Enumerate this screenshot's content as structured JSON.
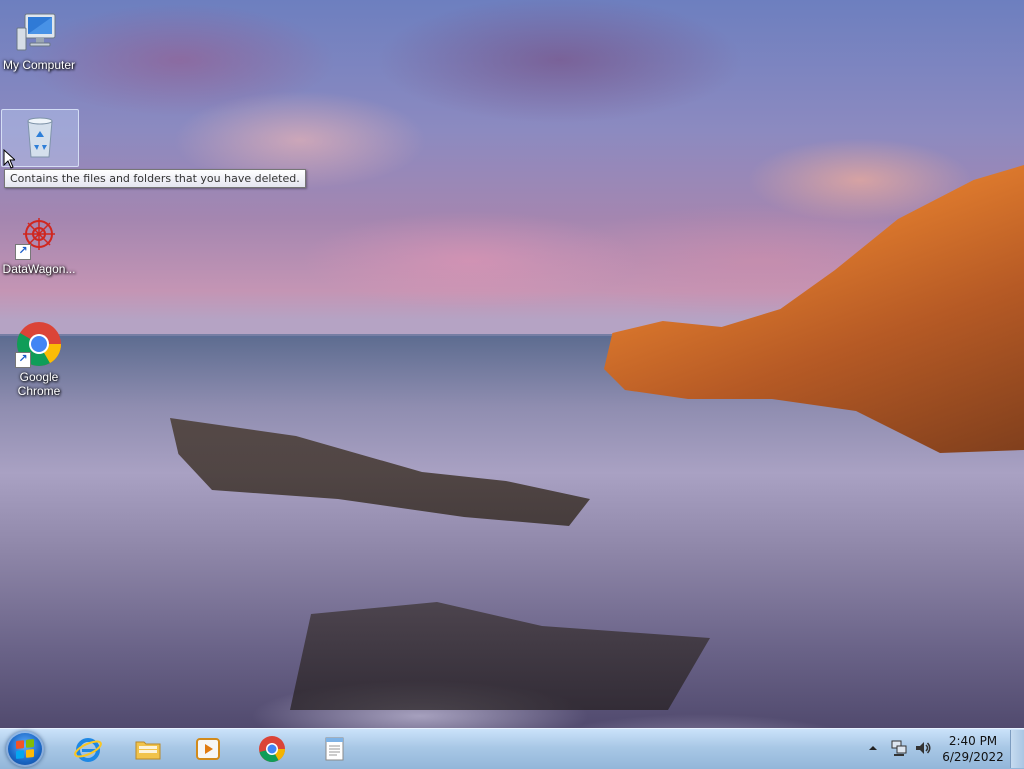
{
  "desktop": {
    "icons": [
      {
        "label": "My Computer",
        "icon": "computer-icon"
      },
      {
        "label": "Recycle Bin",
        "icon": "recycle-bin-icon",
        "selected": true
      },
      {
        "label": "DataWagon...",
        "icon": "datawagon-icon",
        "shortcut": true
      },
      {
        "label": "Google Chrome",
        "icon": "chrome-icon",
        "shortcut": true
      }
    ],
    "tooltip": "Contains the files and folders that you have deleted."
  },
  "taskbar": {
    "start": {
      "icon": "windows-start-icon"
    },
    "pinned": [
      {
        "name": "Internet Explorer",
        "icon": "internet-explorer-icon"
      },
      {
        "name": "Windows Explorer",
        "icon": "folder-icon"
      },
      {
        "name": "Windows Media Player",
        "icon": "media-player-icon"
      },
      {
        "name": "Google Chrome",
        "icon": "chrome-icon"
      },
      {
        "name": "Notepad",
        "icon": "notepad-icon"
      }
    ],
    "tray": {
      "icons": [
        "show-hidden-icons-arrow",
        "network-icon",
        "volume-icon"
      ],
      "time": "2:40 PM",
      "date": "6/29/2022"
    }
  },
  "colors": {
    "taskbar": "#a9c8e6",
    "start_orb": "#1a66c4",
    "tooltip_border": "#767676"
  }
}
